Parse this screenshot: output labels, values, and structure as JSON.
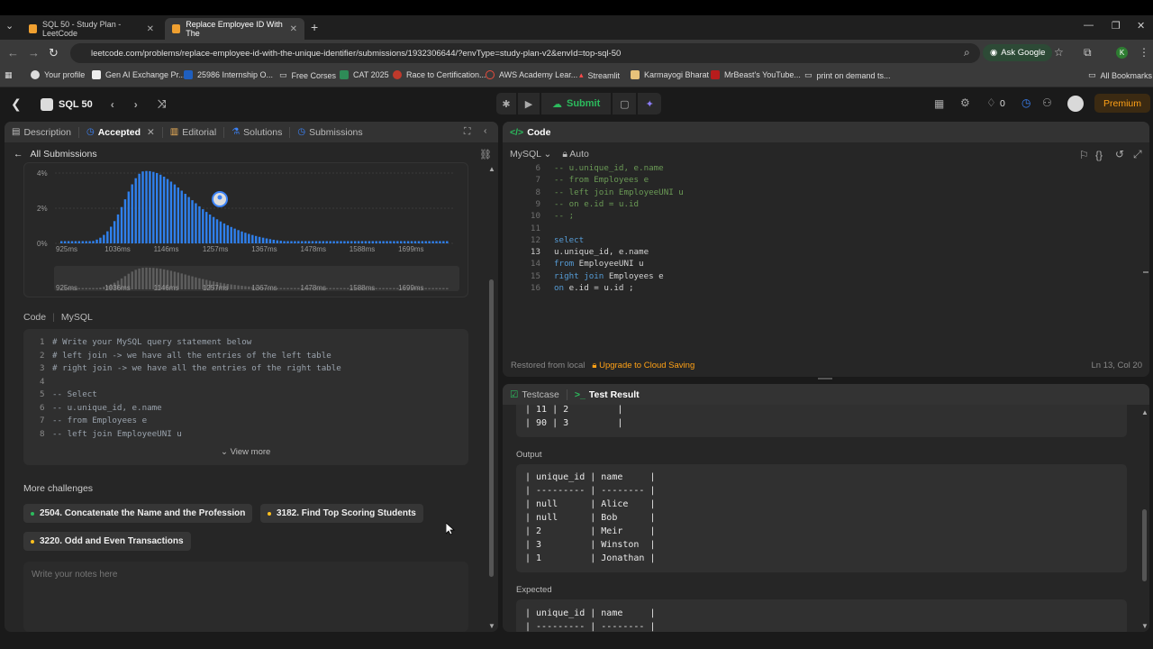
{
  "browser": {
    "tabs": [
      {
        "title": "SQL 50 - Study Plan - LeetCode",
        "active": false
      },
      {
        "title": "Replace Employee ID With The",
        "active": true
      }
    ],
    "url": "leetcode.com/problems/replace-employee-id-with-the-unique-identifier/submissions/1932306644/?envType=study-plan-v2&envId=top-sql-50",
    "ask_google": "Ask Google",
    "profile_initial": "K",
    "bookmarks": [
      "Your profile",
      "Gen AI Exchange Pr...",
      "25986 Internship O...",
      "Free Corses",
      "CAT 2025",
      "Race to Certification...",
      "AWS Academy Lear...",
      "Streamlit",
      "Karmayogi Bharat",
      "MrBeast's YouTube...",
      "print on demand ts..."
    ],
    "all_bookmarks": "All Bookmarks"
  },
  "header": {
    "study_plan": "SQL 50",
    "submit": "Submit",
    "streak": "0",
    "premium": "Premium"
  },
  "left": {
    "tabs": [
      "Description",
      "Accepted",
      "Editorial",
      "Solutions",
      "Submissions"
    ],
    "all_submissions": "All Submissions",
    "histogram": {
      "y_ticks": [
        "4%",
        "2%",
        "0%"
      ],
      "x_ticks": [
        "925ms",
        "1036ms",
        "1146ms",
        "1257ms",
        "1367ms",
        "1478ms",
        "1588ms",
        "1699ms"
      ]
    },
    "code_label": "Code",
    "code_lang": "MySQL",
    "code_lines": [
      {
        "n": "1",
        "t": "# Write your MySQL query statement below"
      },
      {
        "n": "2",
        "t": "# left join -> we have all the entries of the left table"
      },
      {
        "n": "3",
        "t": "# right join -> we have all the entries of the right table"
      },
      {
        "n": "4",
        "t": ""
      },
      {
        "n": "5",
        "t": "-- Select"
      },
      {
        "n": "6",
        "t": "-- u.unique_id, e.name"
      },
      {
        "n": "7",
        "t": "-- from Employees e"
      },
      {
        "n": "8",
        "t": "-- left join EmployeeUNI u"
      }
    ],
    "view_more": "View more",
    "more_challenges": "More challenges",
    "challenges": [
      {
        "label": "2504. Concatenate the Name and the Profession",
        "color": "#2cbb5d"
      },
      {
        "label": "3182. Find Top Scoring Students",
        "color": "#ffc01e"
      },
      {
        "label": "3220. Odd and Even Transactions",
        "color": "#ffc01e"
      }
    ],
    "notes_placeholder": "Write your notes here"
  },
  "code_panel": {
    "title": "Code",
    "language": "MySQL",
    "auto": "Auto",
    "lines": [
      {
        "n": "6",
        "t": "-- u.unique_id, e.name",
        "k": "cm"
      },
      {
        "n": "7",
        "t": "-- from Employees e",
        "k": "cm"
      },
      {
        "n": "8",
        "t": "-- left join EmployeeUNI u",
        "k": "cm"
      },
      {
        "n": "9",
        "t": "-- on e.id = u.id",
        "k": "cm"
      },
      {
        "n": "10",
        "t": "-- ;",
        "k": "cm"
      },
      {
        "n": "11",
        "t": "",
        "k": "tx"
      },
      {
        "n": "12",
        "t": "select",
        "k": "kw"
      },
      {
        "n": "13",
        "t": "u.unique_id, e.name",
        "k": "tx"
      },
      {
        "n": "14",
        "t": "from EmployeeUNI u",
        "k": "mix1"
      },
      {
        "n": "15",
        "t": "right join Employees e",
        "k": "mix2"
      },
      {
        "n": "16",
        "t": "on e.id = u.id ;",
        "k": "mix3"
      }
    ],
    "restored": "Restored from local",
    "upgrade": "Upgrade to Cloud Saving",
    "cursor": "Ln 13, Col 20"
  },
  "result_panel": {
    "tabs": [
      "Testcase",
      "Test Result"
    ],
    "input_tail": [
      "| 11 | 2         |",
      "| 90 | 3         |"
    ],
    "output_label": "Output",
    "output": [
      "| unique_id | name     |",
      "| --------- | -------- |",
      "| null      | Alice    |",
      "| null      | Bob      |",
      "| 2         | Meir     |",
      "| 3         | Winston  |",
      "| 1         | Jonathan |"
    ],
    "expected_label": "Expected",
    "expected": [
      "| unique_id | name     |",
      "| --------- | -------- |"
    ]
  }
}
